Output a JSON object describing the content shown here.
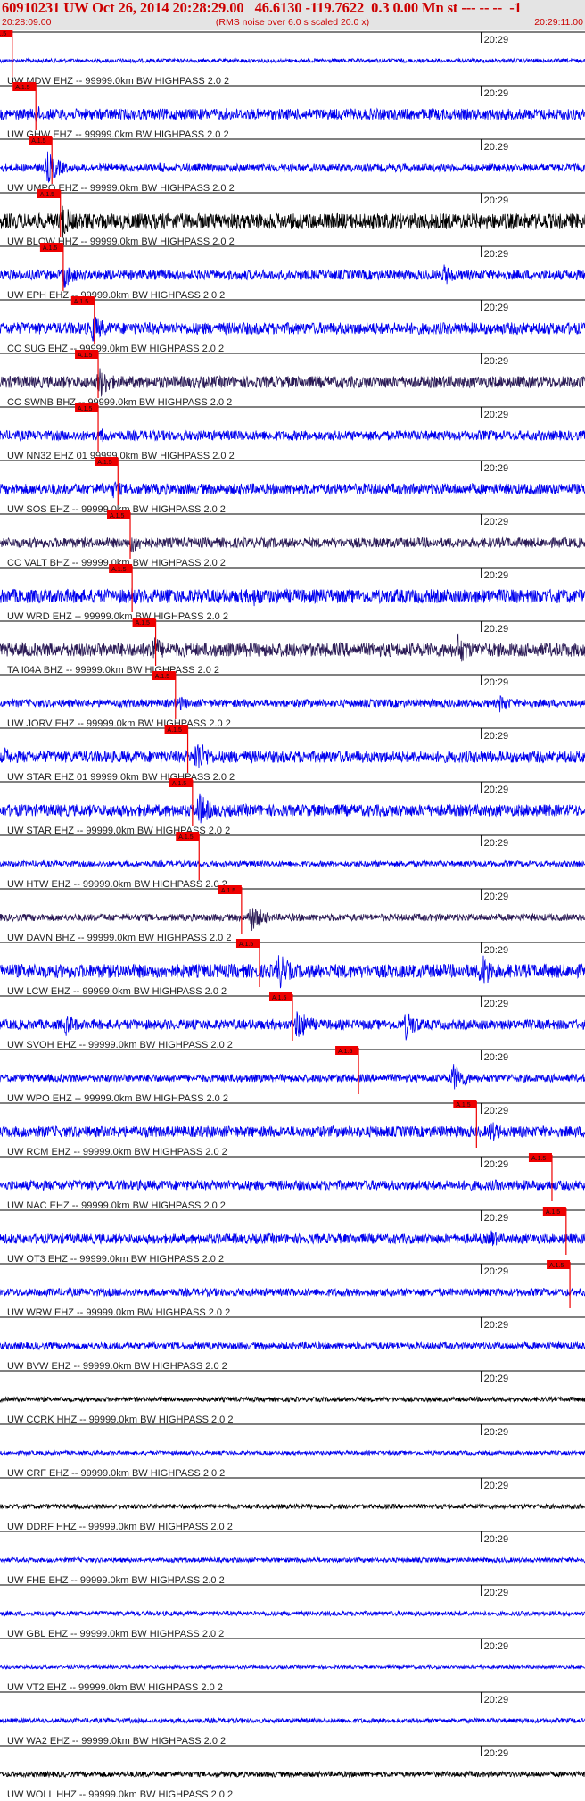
{
  "header": {
    "title": "60910231 UW Oct 26, 2014 20:28:29.00   46.6130 -119.7622  0.3 0.00 Mn st --- -- --  -1",
    "subtitle": "(RMS noise over 6.0 s scaled 20.0 x)",
    "time_start": "20:28:09.00",
    "time_end": "20:29:11.00"
  },
  "colors": {
    "blue_trace": "#0000ee",
    "dark_trace": "#2a1a55",
    "black_trace": "#000000",
    "pick": "#ee0000",
    "header_bg": "#e4e4e4",
    "header_text": "#cc0000"
  },
  "chart_data": {
    "type": "line",
    "title": "60910231 UW Oct 26, 2014 20:28:29.00   46.6130 -119.7622  0.3 0.00 Mn st --- -- --  -1",
    "subtitle": "(RMS noise over 6.0 s scaled 20.0 x)",
    "x_range": [
      "20:28:09.00",
      "20:29:11.00"
    ],
    "x_tick_label": "20:29",
    "grid": false,
    "traces": [
      {
        "label": "UW MDW EHZ -- 99999.0km BW  HIGHPASS  2.0  2",
        "color": "blue",
        "pick": "20:28:10.3",
        "pick_label": "A.1.5",
        "amp": 0.1,
        "bursts": []
      },
      {
        "label": "UW GHW EHZ -- 99999.0km BW  HIGHPASS  2.0  2",
        "color": "blue",
        "pick": "20:28:12.8",
        "pick_label": "A.1.5",
        "amp": 0.28,
        "bursts": [
          [
            12.8,
            0.5
          ]
        ]
      },
      {
        "label": "UW UMPQ EHZ -- 99999.0km BW  HIGHPASS  2.0  2",
        "color": "blue",
        "pick": "20:28:14.5",
        "pick_label": "A.1.5",
        "amp": 0.2,
        "bursts": [
          [
            14.0,
            0.9
          ],
          [
            26.0,
            0.3
          ]
        ]
      },
      {
        "label": "UW BLOW HHZ -- 99999.0km BW  HIGHPASS  2.0  2",
        "color": "black",
        "pick": "20:28:15.4",
        "pick_label": "A.1.5",
        "amp": 0.4,
        "bursts": [
          [
            15.5,
            1.0
          ]
        ]
      },
      {
        "label": "UW EPH EHZ -- 99999.0km BW  HIGHPASS  2.0  2",
        "color": "blue",
        "pick": "20:28:15.7",
        "pick_label": "A.1.5",
        "amp": 0.25,
        "bursts": [
          [
            15.8,
            0.7
          ],
          [
            56.0,
            0.6
          ]
        ]
      },
      {
        "label": "CC SUG EHZ -- 99999.0km BW  HIGHPASS  2.0  2",
        "color": "blue",
        "pick": "20:28:19.0",
        "pick_label": "A.1.5",
        "amp": 0.3,
        "bursts": [
          [
            18.8,
            0.8
          ]
        ]
      },
      {
        "label": "CC SWNB BHZ -- 99999.0km BW  HIGHPASS  2.0  2",
        "color": "dark",
        "pick": "20:28:19.4",
        "pick_label": "A.1.5",
        "amp": 0.3,
        "bursts": [
          [
            19.5,
            0.9
          ]
        ]
      },
      {
        "label": "UW NN32 EHZ 01 99999.0km BW  HIGHPASS  2.0  2",
        "color": "blue",
        "pick": "20:28:19.4",
        "pick_label": "A.1.5",
        "amp": 0.25,
        "bursts": [
          [
            19.8,
            0.4
          ]
        ]
      },
      {
        "label": "UW SOS EHZ -- 99999.0km BW  HIGHPASS  2.0  2",
        "color": "blue",
        "pick": "20:28:21.5",
        "pick_label": "A.1.5",
        "amp": 0.28,
        "bursts": [
          [
            21.0,
            0.5
          ]
        ]
      },
      {
        "label": "CC VALT BHZ -- 99999.0km BW  HIGHPASS  2.0  2",
        "color": "dark",
        "pick": "20:28:22.8",
        "pick_label": "A.1.5",
        "amp": 0.25,
        "bursts": [
          [
            23.0,
            0.6
          ]
        ]
      },
      {
        "label": "UW WRD EHZ -- 99999.0km BW  HIGHPASS  2.0  2",
        "color": "blue",
        "pick": "20:28:23.0",
        "pick_label": "A.1.5",
        "amp": 0.35,
        "bursts": [
          [
            23.0,
            0.5
          ],
          [
            36.0,
            0.6
          ]
        ]
      },
      {
        "label": "TA I04A BHZ -- 99999.0km BW  HIGHPASS  2.0  2",
        "color": "dark",
        "pick": "20:28:25.5",
        "pick_label": "A.1.5",
        "amp": 0.35,
        "bursts": [
          [
            25.0,
            0.9
          ],
          [
            57.5,
            0.9
          ]
        ]
      },
      {
        "label": "UW JORV EHZ -- 99999.0km BW  HIGHPASS  2.0  2",
        "color": "blue",
        "pick": "20:28:27.6",
        "pick_label": "A.1.5",
        "amp": 0.2,
        "bursts": [
          [
            28.0,
            0.4
          ],
          [
            62.0,
            0.5
          ]
        ]
      },
      {
        "label": "UW STAR EHZ 01 99999.0km BW  HIGHPASS  2.0  2",
        "color": "blue",
        "pick": "20:28:28.9",
        "pick_label": "A.1.5",
        "amp": 0.3,
        "bursts": [
          [
            29.8,
            1.0
          ],
          [
            9.5,
            0.5
          ]
        ]
      },
      {
        "label": "UW STAR EHZ -- 99999.0km BW  HIGHPASS  2.0  2",
        "color": "blue",
        "pick": "20:28:29.4",
        "pick_label": "A.1.5",
        "amp": 0.3,
        "bursts": [
          [
            30.0,
            1.0
          ]
        ]
      },
      {
        "label": "UW HTW EHZ -- 99999.0km BW  HIGHPASS  2.0  2",
        "color": "blue",
        "pick": "20:28:30.1",
        "pick_label": "A.1.5",
        "amp": 0.15,
        "bursts": []
      },
      {
        "label": "UW DAVN BHZ -- 99999.0km BW  HIGHPASS  2.0  2",
        "color": "dark",
        "pick": "20:28:34.6",
        "pick_label": "A.1.5",
        "amp": 0.18,
        "bursts": [
          [
            35.5,
            0.8
          ]
        ]
      },
      {
        "label": "UW LCW EHZ -- 99999.0km BW  HIGHPASS  2.0  2",
        "color": "blue",
        "pick": "20:28:36.5",
        "pick_label": "A.1.5",
        "amp": 0.35,
        "bursts": [
          [
            38.5,
            1.0
          ],
          [
            60.0,
            1.0
          ]
        ]
      },
      {
        "label": "UW SVOH EHZ -- 99999.0km BW  HIGHPASS  2.0  2",
        "color": "blue",
        "pick": "20:28:40.0",
        "pick_label": "A.1.5",
        "amp": 0.25,
        "bursts": [
          [
            40.5,
            0.9
          ],
          [
            52.0,
            0.8
          ],
          [
            16.0,
            0.6
          ]
        ]
      },
      {
        "label": "UW WPO EHZ -- 99999.0km BW  HIGHPASS  2.0  2",
        "color": "blue",
        "pick": "20:28:47.0",
        "pick_label": "A.1.5",
        "amp": 0.2,
        "bursts": [
          [
            57.0,
            0.8
          ]
        ]
      },
      {
        "label": "UW RCM EHZ -- 99999.0km BW  HIGHPASS  2.0  2",
        "color": "blue",
        "pick": "20:28:59.5",
        "pick_label": "A.1.5",
        "amp": 0.28,
        "bursts": [
          [
            61.0,
            0.6
          ]
        ]
      },
      {
        "label": "UW NAC EHZ -- 99999.0km BW  HIGHPASS  2.0  2",
        "color": "blue",
        "pick": "20:29:07.5",
        "pick_label": "A.1.5",
        "amp": 0.25,
        "bursts": [
          [
            61.5,
            0.3
          ]
        ]
      },
      {
        "label": "UW OT3 EHZ -- 99999.0km BW  HIGHPASS  2.0  2",
        "color": "blue",
        "pick": "20:29:09.0",
        "pick_label": "A.1.5",
        "amp": 0.25,
        "bursts": [
          [
            61.0,
            0.5
          ]
        ]
      },
      {
        "label": "UW WRW EHZ -- 99999.0km BW  HIGHPASS  2.0  2",
        "color": "blue",
        "pick": "20:29:09.4",
        "pick_label": "A.1.5",
        "amp": 0.2,
        "bursts": []
      },
      {
        "label": "UW BVW EHZ -- 99999.0km BW  HIGHPASS  2.0  2",
        "color": "blue",
        "pick": "",
        "pick_label": "",
        "amp": 0.18,
        "bursts": []
      },
      {
        "label": "UW CCRK HHZ -- 99999.0km BW  HIGHPASS  2.0  2",
        "color": "black",
        "pick": "",
        "pick_label": "",
        "amp": 0.12,
        "bursts": []
      },
      {
        "label": "UW CRF EHZ -- 99999.0km BW  HIGHPASS  2.0  2",
        "color": "blue",
        "pick": "",
        "pick_label": "",
        "amp": 0.1,
        "bursts": []
      },
      {
        "label": "UW DDRF HHZ -- 99999.0km BW  HIGHPASS  2.0  2",
        "color": "black",
        "pick": "",
        "pick_label": "",
        "amp": 0.12,
        "bursts": []
      },
      {
        "label": "UW FHE EHZ -- 99999.0km BW  HIGHPASS  2.0  2",
        "color": "blue",
        "pick": "",
        "pick_label": "",
        "amp": 0.12,
        "bursts": []
      },
      {
        "label": "UW GBL EHZ -- 99999.0km BW  HIGHPASS  2.0  2",
        "color": "blue",
        "pick": "",
        "pick_label": "",
        "amp": 0.12,
        "bursts": []
      },
      {
        "label": "UW VT2 EHZ -- 99999.0km BW  HIGHPASS  2.0  2",
        "color": "blue",
        "pick": "",
        "pick_label": "",
        "amp": 0.08,
        "bursts": []
      },
      {
        "label": "UW WA2 EHZ -- 99999.0km BW  HIGHPASS  2.0  2",
        "color": "blue",
        "pick": "",
        "pick_label": "",
        "amp": 0.12,
        "bursts": []
      },
      {
        "label": "UW WOLL HHZ -- 99999.0km BW  HIGHPASS  2.0  2",
        "color": "black",
        "pick": "",
        "pick_label": "",
        "amp": 0.14,
        "bursts": []
      }
    ]
  }
}
